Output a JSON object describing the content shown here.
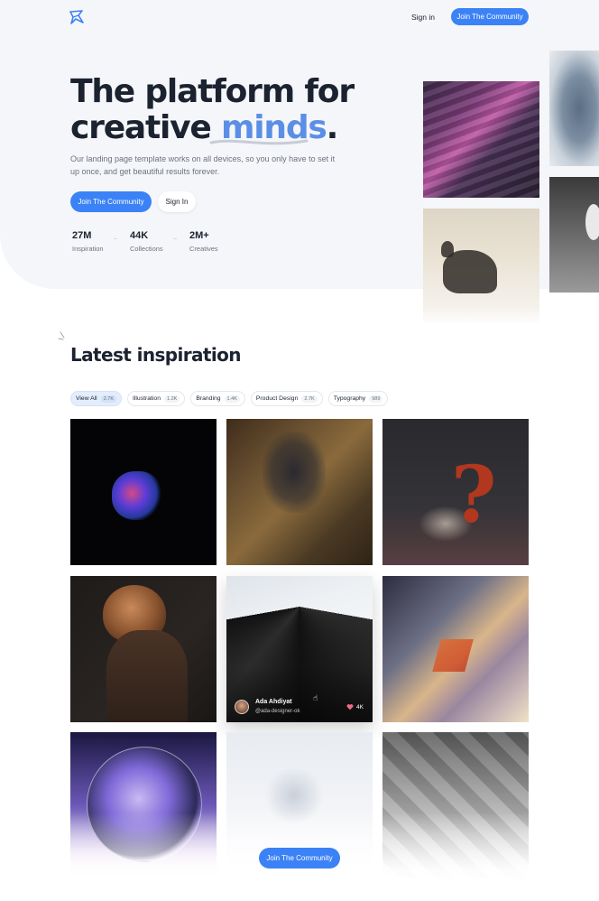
{
  "header": {
    "logo_icon": "star-burst-icon",
    "signin_label": "Sign in",
    "join_label": "Join The Community"
  },
  "hero": {
    "title_line1": "The platform for",
    "title_line2_prefix": "creative ",
    "title_line2_accent": "minds",
    "title_line2_suffix": ".",
    "subtitle": "Our landing page template works on all devices, so you only have to set it up once, and get beautiful results forever.",
    "primary_button": "Join The Community",
    "secondary_button": "Sign In",
    "stats": [
      {
        "value": "27M",
        "label": "Inspiration"
      },
      {
        "value": "44K",
        "label": "Collections"
      },
      {
        "value": "2M+",
        "label": "Creatives"
      }
    ],
    "stat_separator": "~"
  },
  "section": {
    "title": "Latest inspiration",
    "filters": [
      {
        "label": "View All",
        "count": "2.7K",
        "active": true
      },
      {
        "label": "Illustration",
        "count": "1.2K",
        "active": false
      },
      {
        "label": "Branding",
        "count": "1.4K",
        "active": false
      },
      {
        "label": "Product Design",
        "count": "2.7K",
        "active": false
      },
      {
        "label": "Typography",
        "count": "989",
        "active": false
      }
    ]
  },
  "featured_card": {
    "author_name": "Ada Ahdiyat",
    "author_handle": "@ada-designer-ok",
    "likes": "4K",
    "like_icon": "heart-icon"
  },
  "footer_cta": {
    "label": "Join The Community"
  },
  "colors": {
    "accent": "#3b82f6",
    "accent_text": "#5b8fe6",
    "heading": "#1b2230",
    "muted": "#6b7280",
    "hero_bg": "#f5f6f9"
  }
}
